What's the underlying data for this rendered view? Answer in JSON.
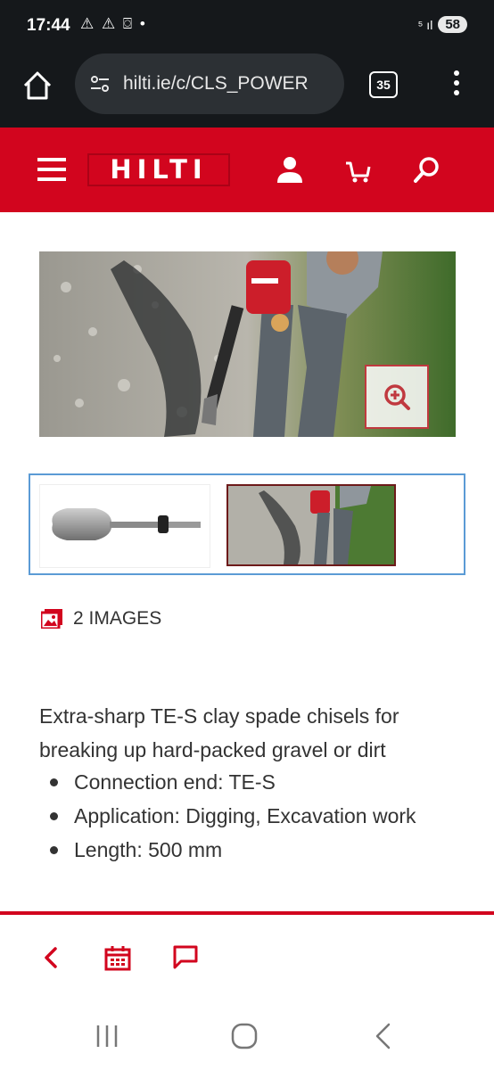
{
  "status_bar": {
    "time": "17:44",
    "notifications": "⚠ ⚠ ⌼ •",
    "signal": "⁵ ıl",
    "battery": "58"
  },
  "browser": {
    "url": "hilti.ie/c/CLS_POWER",
    "tab_count": "35"
  },
  "header": {
    "brand": "HILTI"
  },
  "gallery": {
    "images_count_label": "2 IMAGES"
  },
  "product": {
    "description": "Extra-sharp TE-S clay spade chisels for breaking up hard-packed gravel or dirt",
    "bullets": [
      "Connection end: TE-S",
      "Application: Digging, Excavation work",
      "Length: 500 mm"
    ]
  },
  "colors": {
    "brand_red": "#d2051e",
    "thumb_border": "#5b9bd5",
    "dark_bar": "#15181b"
  }
}
